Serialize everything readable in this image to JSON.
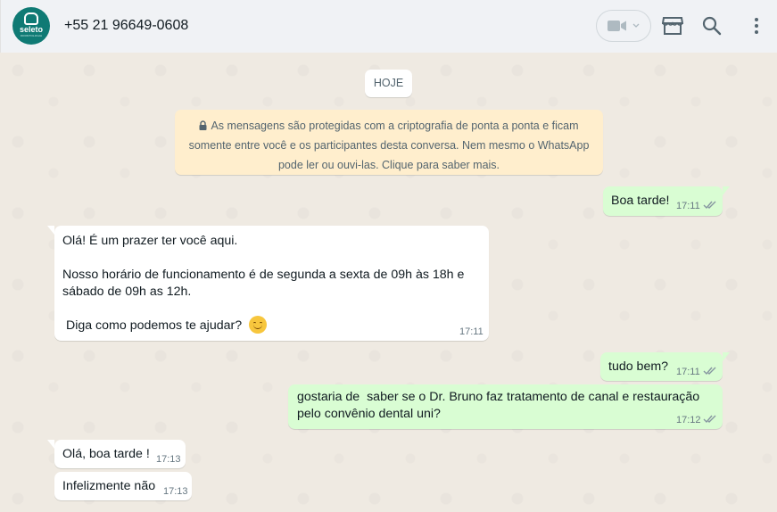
{
  "header": {
    "contact_name": "+55 21 96649-0608",
    "avatar_brand": "seleto",
    "avatar_sub": "ODONTOLOGIA",
    "icons": [
      "video-call-icon",
      "chevron-down-icon",
      "store-icon",
      "search-icon",
      "menu-icon"
    ]
  },
  "chat": {
    "date_chip": "HOJE",
    "e2e_notice": "As mensagens são protegidas com a criptografia de ponta a ponta e ficam somente entre você e os participantes desta conversa. Nem mesmo o WhatsApp pode ler ou ouvi-las. Clique para saber mais.",
    "messages": [
      {
        "dir": "out",
        "lines": [
          "Boa tarde!"
        ],
        "time": "17:11",
        "ticks": "read"
      },
      {
        "dir": "in",
        "lines": [
          "Olá! É um prazer ter você aqui.",
          "",
          "Nosso horário de funcionamento é de segunda a sexta de 09h às 18h e",
          "sábado de 09h as 12h.",
          "",
          " Diga como podemos te ajudar? "
        ],
        "emoji": "smiling-face",
        "time": "17:11"
      },
      {
        "dir": "out",
        "lines": [
          "tudo bem?"
        ],
        "time": "17:11",
        "ticks": "read"
      },
      {
        "dir": "out",
        "lines": [
          "gostaria de  saber se o Dr. Bruno faz tratamento de canal e restauração",
          "pelo convênio dental uni?"
        ],
        "time": "17:12",
        "ticks": "read"
      },
      {
        "dir": "in",
        "lines": [
          "Olá, boa tarde !"
        ],
        "time": "17:13"
      },
      {
        "dir": "in",
        "lines": [
          "Infelizmente não"
        ],
        "time": "17:13"
      }
    ]
  },
  "colors": {
    "outgoing_bubble": "#d9fdd3",
    "incoming_bubble": "#ffffff",
    "chat_background": "#efeae2",
    "notice_background": "#ffeecd",
    "read_ticks": "#8696a0"
  }
}
